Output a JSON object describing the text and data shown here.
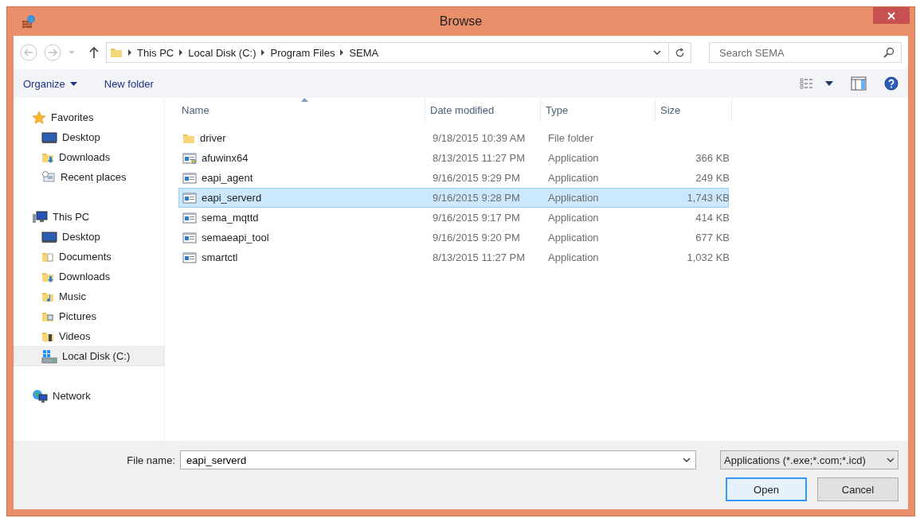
{
  "window": {
    "title": "Browse"
  },
  "address": {
    "crumbs": [
      "This PC",
      "Local Disk (C:)",
      "Program Files",
      "SEMA"
    ]
  },
  "search": {
    "placeholder": "Search SEMA"
  },
  "toolbar": {
    "organize": "Organize",
    "new_folder": "New folder"
  },
  "sidebar": {
    "groups": [
      {
        "label": "Favorites",
        "kind": "star",
        "selected": false,
        "children": [
          {
            "label": "Desktop",
            "kind": "desktop",
            "selected": false
          },
          {
            "label": "Downloads",
            "kind": "downloads",
            "selected": false
          },
          {
            "label": "Recent places",
            "kind": "recent",
            "selected": false
          }
        ]
      },
      {
        "label": "This PC",
        "kind": "pc",
        "selected": false,
        "children": [
          {
            "label": "Desktop",
            "kind": "desktop",
            "selected": false
          },
          {
            "label": "Documents",
            "kind": "documents",
            "selected": false
          },
          {
            "label": "Downloads",
            "kind": "downloads",
            "selected": false
          },
          {
            "label": "Music",
            "kind": "music",
            "selected": false
          },
          {
            "label": "Pictures",
            "kind": "pictures",
            "selected": false
          },
          {
            "label": "Videos",
            "kind": "videos",
            "selected": false
          },
          {
            "label": "Local Disk (C:)",
            "kind": "drive",
            "selected": true
          }
        ]
      },
      {
        "label": "Network",
        "kind": "network",
        "selected": false
      }
    ]
  },
  "table": {
    "columns": [
      {
        "label": "Name",
        "sorted": true
      },
      {
        "label": "Date modified",
        "sorted": false
      },
      {
        "label": "Type",
        "sorted": false
      },
      {
        "label": "Size",
        "sorted": false
      }
    ],
    "rows": [
      {
        "kind": "folder",
        "name": "driver",
        "date": "9/18/2015 10:39 AM",
        "type": "File folder",
        "selected": false
      },
      {
        "kind": "installer",
        "name": "afuwinx64",
        "date": "8/13/2015 11:27 PM",
        "type": "Application",
        "size": "366 KB",
        "selected": false
      },
      {
        "kind": "app",
        "name": "eapi_agent",
        "date": "9/16/2015 9:29 PM",
        "type": "Application",
        "size": "249 KB",
        "selected": false
      },
      {
        "kind": "app",
        "name": "eapi_serverd",
        "date": "9/16/2015 9:28 PM",
        "type": "Application",
        "size": "1,743 KB",
        "selected": true
      },
      {
        "kind": "app",
        "name": "sema_mqttd",
        "date": "9/16/2015 9:17 PM",
        "type": "Application",
        "size": "414 KB",
        "selected": false
      },
      {
        "kind": "app",
        "name": "semaeapi_tool",
        "date": "9/16/2015 9:20 PM",
        "type": "Application",
        "size": "677 KB",
        "selected": false
      },
      {
        "kind": "app",
        "name": "smartctl",
        "date": "8/13/2015 11:27 PM",
        "type": "Application",
        "size": "1,032 KB",
        "selected": false
      }
    ]
  },
  "footer": {
    "file_name_label": "File name:",
    "file_name": "eapi_serverd",
    "filter": "Applications (*.exe;*.com;*.icd)",
    "buttons": [
      {
        "label": "Open",
        "default": true
      },
      {
        "label": "Cancel",
        "default": false
      }
    ]
  }
}
